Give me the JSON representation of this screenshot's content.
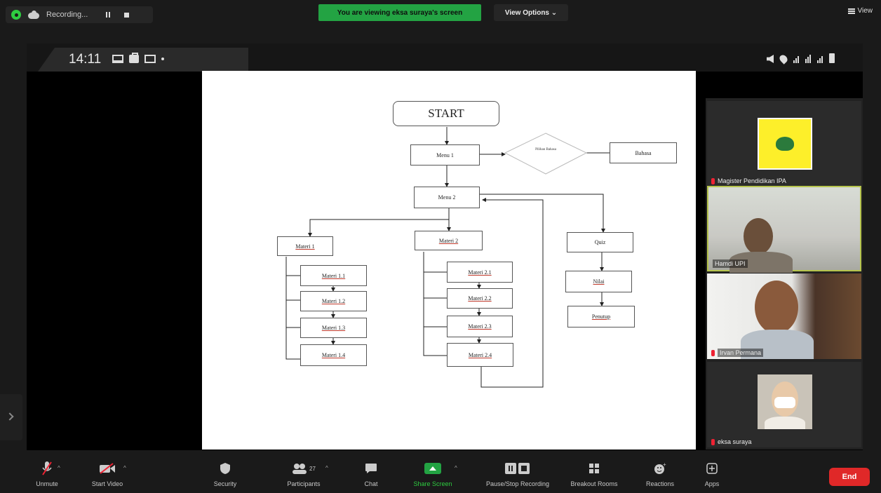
{
  "top_bar": {
    "recording_label": "Recording...",
    "viewing_banner": "You are viewing eksa suraya's screen",
    "view_options": "View Options ⌄",
    "view_label": "View"
  },
  "phone_status": {
    "time": "14:11"
  },
  "flowchart": {
    "start": "START",
    "menu1": "Menu 1",
    "diamond": "Pilihan Bahasa",
    "bahasa": "Bahasa",
    "menu2": "Menu 2",
    "materi1": "Materi 1",
    "materi2": "Materi 2",
    "quiz": "Quiz",
    "materi1_items": [
      "Materi 1.1",
      "Materi 1.2",
      "Materi 1.3",
      "Materi 1.4"
    ],
    "materi2_items": [
      "Materi 2.1",
      "Materi 2.2",
      "Materi 2.3",
      "Materi 2.4"
    ],
    "nilai": "Nilai",
    "penutup": "Penutup"
  },
  "participants": [
    {
      "name": "Magister Pendidikan IPA"
    },
    {
      "name": "Hamdi UPI"
    },
    {
      "name": "Irvan Permana"
    },
    {
      "name": "eksa suraya"
    }
  ],
  "toolbar": {
    "unmute": "Unmute",
    "start_video": "Start Video",
    "security": "Security",
    "participants": "Participants",
    "participant_count": "27",
    "chat": "Chat",
    "share_screen": "Share Screen",
    "pause_stop": "Pause/Stop Recording",
    "breakout": "Breakout Rooms",
    "reactions": "Reactions",
    "apps": "Apps",
    "end": "End"
  },
  "colors": {
    "share_green": "#23a343",
    "end_red": "#e02828",
    "active_speaker_border": "#b6c44d"
  }
}
